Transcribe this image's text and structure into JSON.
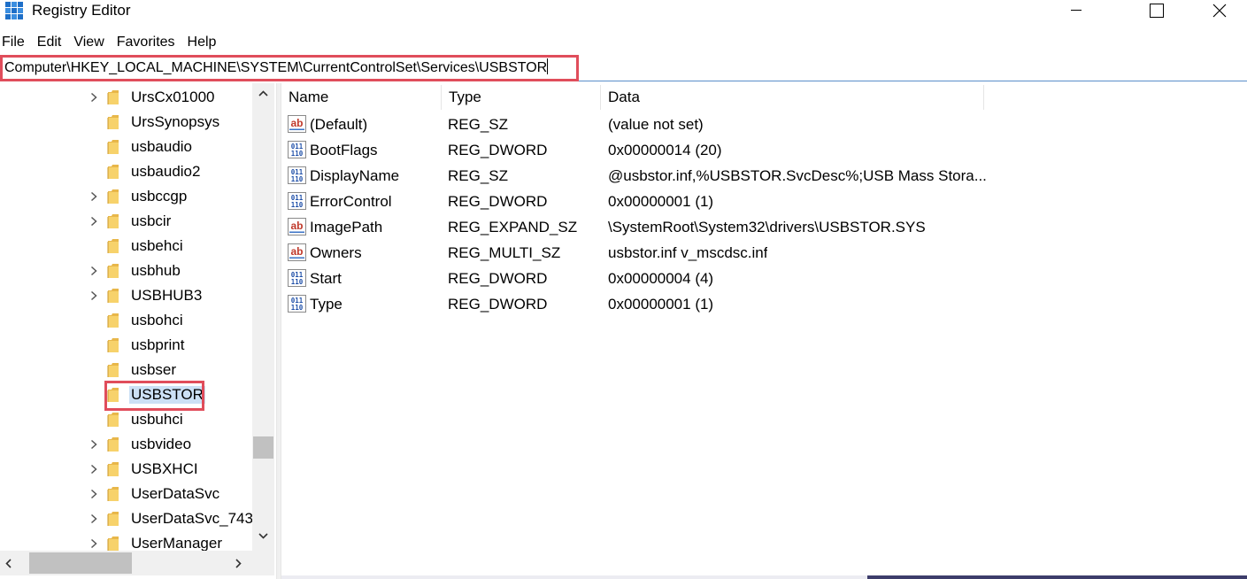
{
  "window": {
    "title": "Registry Editor"
  },
  "menu": [
    "File",
    "Edit",
    "View",
    "Favorites",
    "Help"
  ],
  "address": {
    "path": "Computer\\HKEY_LOCAL_MACHINE\\SYSTEM\\CurrentControlSet\\Services\\USBSTOR"
  },
  "tree": {
    "items": [
      {
        "label": "UrsCx01000",
        "expandable": true,
        "selected": false
      },
      {
        "label": "UrsSynopsys",
        "expandable": false,
        "selected": false
      },
      {
        "label": "usbaudio",
        "expandable": false,
        "selected": false
      },
      {
        "label": "usbaudio2",
        "expandable": false,
        "selected": false
      },
      {
        "label": "usbccgp",
        "expandable": true,
        "selected": false
      },
      {
        "label": "usbcir",
        "expandable": true,
        "selected": false
      },
      {
        "label": "usbehci",
        "expandable": false,
        "selected": false
      },
      {
        "label": "usbhub",
        "expandable": true,
        "selected": false
      },
      {
        "label": "USBHUB3",
        "expandable": true,
        "selected": false
      },
      {
        "label": "usbohci",
        "expandable": false,
        "selected": false
      },
      {
        "label": "usbprint",
        "expandable": false,
        "selected": false
      },
      {
        "label": "usbser",
        "expandable": false,
        "selected": false
      },
      {
        "label": "USBSTOR",
        "expandable": false,
        "selected": true
      },
      {
        "label": "usbuhci",
        "expandable": false,
        "selected": false
      },
      {
        "label": "usbvideo",
        "expandable": true,
        "selected": false
      },
      {
        "label": "USBXHCI",
        "expandable": true,
        "selected": false
      },
      {
        "label": "UserDataSvc",
        "expandable": true,
        "selected": false
      },
      {
        "label": "UserDataSvc_743",
        "expandable": true,
        "selected": false
      },
      {
        "label": "UserManager",
        "expandable": true,
        "selected": false
      }
    ]
  },
  "list": {
    "columns": {
      "name": "Name",
      "type": "Type",
      "data": "Data"
    },
    "rows": [
      {
        "icon": "string-value-icon",
        "name": "(Default)",
        "type": "REG_SZ",
        "data": "(value not set)"
      },
      {
        "icon": "binary-value-icon",
        "name": "BootFlags",
        "type": "REG_DWORD",
        "data": "0x00000014 (20)"
      },
      {
        "icon": "binary-value-icon",
        "name": "DisplayName",
        "type": "REG_SZ",
        "data": "@usbstor.inf,%USBSTOR.SvcDesc%;USB Mass Stora..."
      },
      {
        "icon": "binary-value-icon",
        "name": "ErrorControl",
        "type": "REG_DWORD",
        "data": "0x00000001 (1)"
      },
      {
        "icon": "string-value-icon",
        "name": "ImagePath",
        "type": "REG_EXPAND_SZ",
        "data": "\\SystemRoot\\System32\\drivers\\USBSTOR.SYS"
      },
      {
        "icon": "string-value-icon",
        "name": "Owners",
        "type": "REG_MULTI_SZ",
        "data": "usbstor.inf v_mscdsc.inf"
      },
      {
        "icon": "binary-value-icon",
        "name": "Start",
        "type": "REG_DWORD",
        "data": "0x00000004 (4)"
      },
      {
        "icon": "binary-value-icon",
        "name": "Type",
        "type": "REG_DWORD",
        "data": "0x00000001 (1)"
      }
    ]
  },
  "colors": {
    "highlight": "#e04d5b",
    "selection": "#cce0f5",
    "accent": "#5a8ec9"
  }
}
